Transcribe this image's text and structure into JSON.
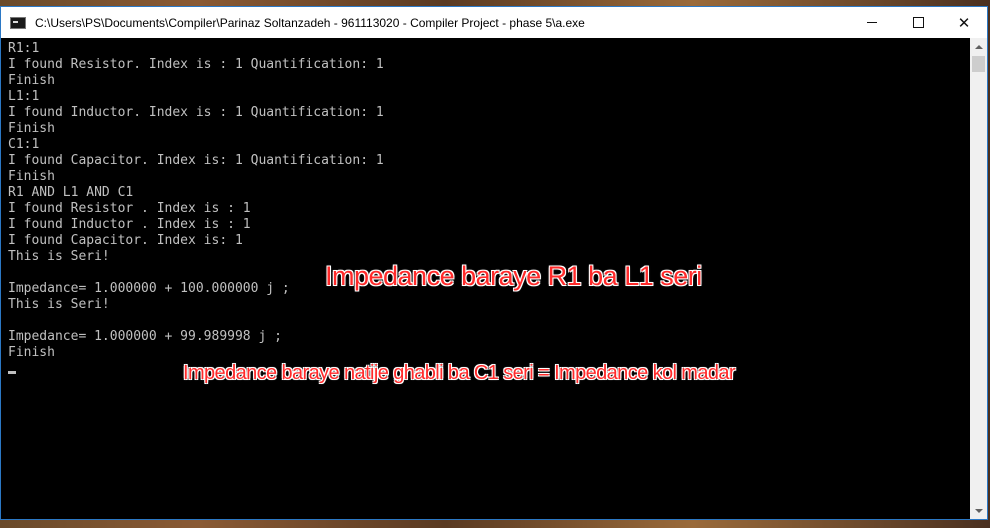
{
  "window": {
    "title": "C:\\Users\\PS\\Documents\\Compiler\\Parinaz Soltanzadeh - 961113020 - Compiler Project - phase 5\\a.exe"
  },
  "console": {
    "lines": [
      "R1:1",
      "I found Resistor. Index is : 1 Quantification: 1",
      "Finish",
      "L1:1",
      "I found Inductor. Index is : 1 Quantification: 1",
      "Finish",
      "C1:1",
      "I found Capacitor. Index is: 1 Quantification: 1",
      "Finish",
      "R1 AND L1 AND C1",
      "I found Resistor . Index is : 1",
      "I found Inductor . Index is : 1",
      "I found Capacitor. Index is: 1",
      "This is Seri!",
      "",
      "Impedance= 1.000000 + 100.000000 j ;",
      "This is Seri!",
      "",
      "Impedance= 1.000000 + 99.989998 j ;",
      "Finish"
    ]
  },
  "annotations": {
    "first": "Impedance baraye R1 ba L1 seri",
    "second": "Impedance baraye natije ghabli ba C1 seri = Impedance kol madar"
  },
  "colors": {
    "console_background": "#000000",
    "console_text": "#c0c0c0",
    "annotation_text": "#ff2a2a",
    "window_border": "#2b78c5"
  },
  "icons": {
    "app": "console-app-icon",
    "minimize": "minimize-icon",
    "maximize": "maximize-icon",
    "close": "close-icon"
  }
}
